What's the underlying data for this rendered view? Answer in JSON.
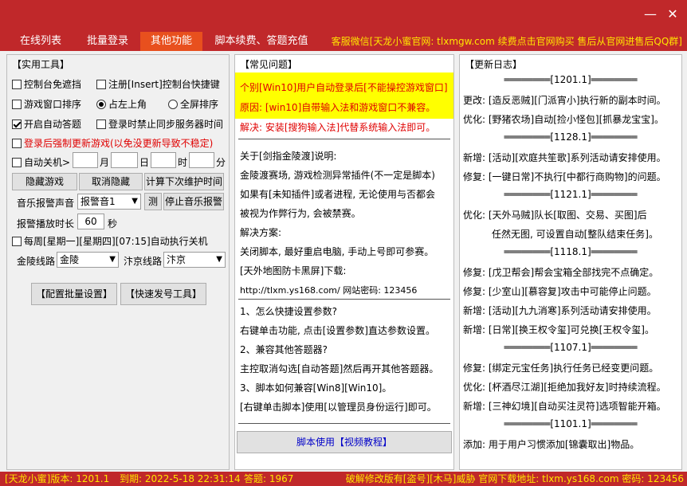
{
  "window": {
    "minimize_glyph": "—",
    "close_glyph": "✕"
  },
  "tabs": [
    {
      "label": "在线列表"
    },
    {
      "label": "批量登录"
    },
    {
      "label": "其他功能"
    },
    {
      "label": "脚本续费、答题充值"
    }
  ],
  "tab_notice": "客服微信[天龙小蜜官网: tlxmgw.com 续费点击官网购买 售后从官网进售后QQ群]",
  "tools": {
    "title": "【实用工具】",
    "cb_console_free": "控制台免遮挡",
    "cb_register_hotkey": "注册[Insert]控制台快捷键",
    "cb_window_sort": "游戏窗口排序",
    "rb_top_left": "占左上角",
    "rb_fullscreen": "全屏排序",
    "cb_auto_answer": "开启自动答题",
    "cb_block_sync": "登录时禁止同步服务器时间",
    "cb_force_update": "登录后强制更新游戏(以免没更新导致不稳定)",
    "cb_auto_shutdown": "自动关机>",
    "unit_month": "月",
    "unit_day": "日",
    "unit_hour": "时",
    "unit_minute": "分",
    "btn_hide_game": "隐藏游戏",
    "btn_cancel_hide": "取消隐藏",
    "btn_calc_maint": "计算下次维护时间",
    "label_alarm_sound": "音乐报警声音",
    "alarm_sound_value": "报警音1",
    "btn_test": "测",
    "btn_stop_alarm": "停止音乐报警",
    "label_alarm_duration": "报警播放时长",
    "alarm_duration_value": "60",
    "unit_second": "秒",
    "cb_weekly_shutdown": "每周[星期一][星期四][07:15]自动执行关机",
    "label_jinling": "金陵线路",
    "jinling_value": "金陵",
    "label_bianjing": "汴京线路",
    "bianjing_value": "汴京",
    "btn_batch_settings": "【配置批量设置】",
    "btn_quick_tool": "【快速发号工具】"
  },
  "faq": {
    "title": "【常见问题】",
    "warn_line1": "个别[Win10]用户自动登录后[不能操控游戏窗口]",
    "warn_line2": "原因: [win10]自带输入法和游戏窗口不兼容。",
    "warn_line3": "解决: 安装[搜狗输入法]代替系统输入法即可。",
    "block1": [
      "关于[剑指金陵渡]说明:",
      "金陵渡赛场, 游戏检测异常插件(不一定是脚本)",
      "如果有[未知插件]或者进程, 无论使用与否都会",
      "被视为作弊行为, 会被禁赛。",
      "解决方案:",
      "关闭脚本, 最好重启电脑, 手动上号即可参赛。",
      "[天外地图防卡黑屏]下载:",
      "http://tlxm.ys168.com/   网站密码: 123456"
    ],
    "block2": [
      "1、怎么快捷设置参数?",
      "右键单击功能, 点击[设置参数]直达参数设置。",
      "2、兼容其他答题器?",
      "主控取消勾选[自动答题]然后再开其他答题器。",
      "3、脚本如何兼容[Win8][Win10]。",
      "[右键单击脚本]使用[以管理员身份运行]即可。"
    ],
    "btn_video": "脚本使用【视频教程】"
  },
  "changelog": {
    "title": "【更新日志】",
    "versions": [
      {
        "header": "[1201.1]",
        "entries": [
          "更改: [造反恶贼][门派宵小]执行新的副本时间。",
          "优化: [野猪农场]自动[捡小怪包][抓暴龙宝宝]。"
        ]
      },
      {
        "header": "[1128.1]",
        "entries": [
          "新增: [活动][欢庭共笙歌]系列活动请安排使用。",
          "修复: [一键日常]不执行[中都行商购物]的问题。"
        ]
      },
      {
        "header": "[1121.1]",
        "entries": [
          "优化: [天外马贼]队长[取图、交易、买图]后",
          "任然无图, 可设置自动[整队结束任务]。"
        ]
      },
      {
        "header": "[1118.1]",
        "entries": [
          "修复: [戊卫帮会]帮会宝箱全部找完不点确定。",
          "修复: [少室山][慕容复]攻击中可能停止问题。",
          "新增: [活动][九九消寒]系列活动请安排使用。",
          "新增: [日常][换王权令玺]可兑换[王权令玺]。"
        ]
      },
      {
        "header": "[1107.1]",
        "entries": [
          "修复: [绑定元宝任务]执行任务已经变更问题。",
          "优化: [杯酒尽江湖][拒绝加我好友]时持续流程。",
          "新增: [三神幻境][自动买注灵符]选项智能开箱。"
        ]
      },
      {
        "header": "[1101.1]",
        "entries": [
          "添加: 用于用户习惯添加[锦囊取出]物品。"
        ]
      }
    ]
  },
  "status": {
    "version": "[天龙小蜜]版本: 1201.1",
    "expiry": "到期: 2022-5-18 22:31:14",
    "answers": "答题: 1967",
    "notice": "破解修改版有[盗号][木马]威胁 官网下载地址: tlxm.ys168.com 密码: 123456"
  },
  "colors": {
    "brand_red": "#c0282a",
    "active_tab": "#e8501e",
    "notice_yellow": "#ffe500",
    "warn_red": "#e00000"
  }
}
